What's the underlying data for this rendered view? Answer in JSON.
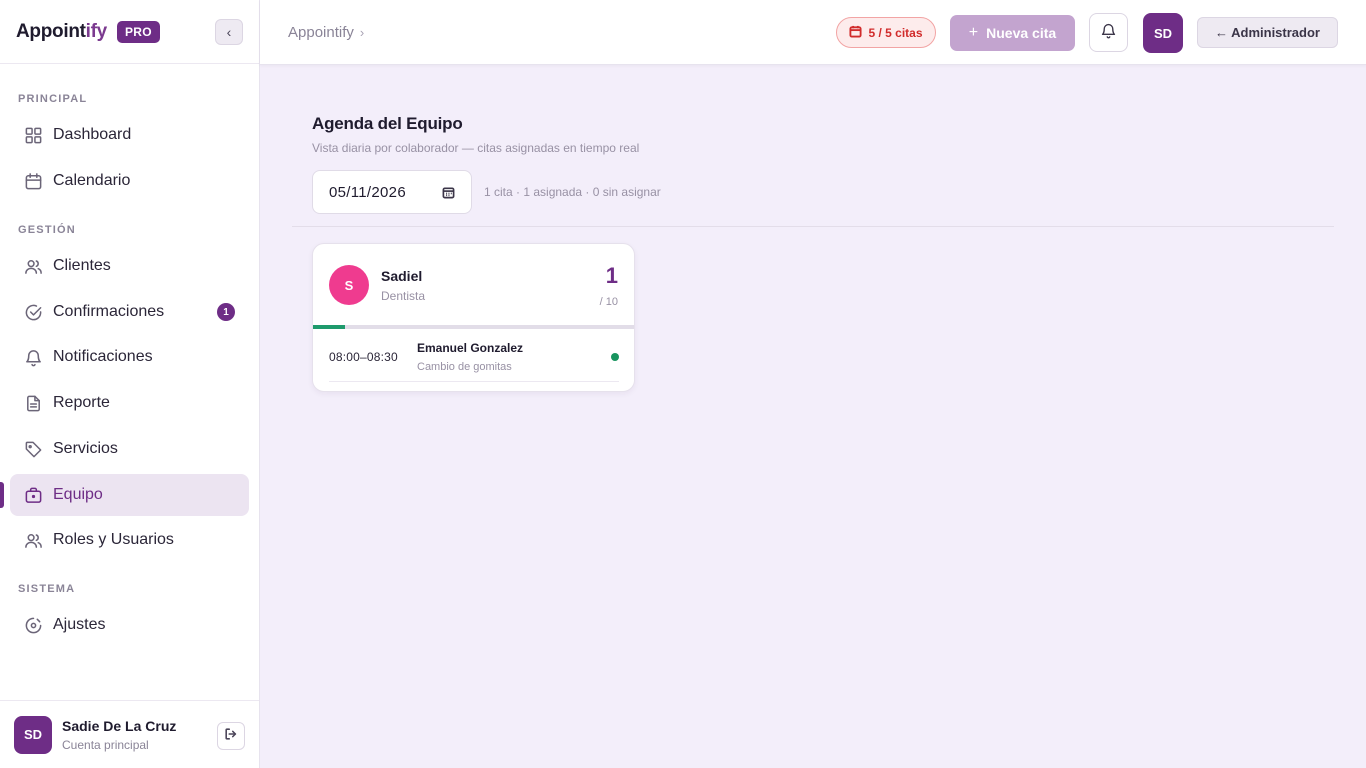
{
  "brand": {
    "name_main": "Appoint",
    "name_accent": "ify",
    "badge": "PRO"
  },
  "sidebar": {
    "sections": {
      "principal": "PRINCIPAL",
      "gestion": "GESTIÓN",
      "sistema": "SISTEMA"
    },
    "items": [
      {
        "label": "Dashboard",
        "icon": "grid-icon"
      },
      {
        "label": "Calendario",
        "icon": "calendar-icon"
      },
      {
        "label": "Clientes",
        "icon": "users-icon"
      },
      {
        "label": "Confirmaciones",
        "icon": "check-circle-icon",
        "badge": "1"
      },
      {
        "label": "Notificaciones",
        "icon": "bell-icon"
      },
      {
        "label": "Reporte",
        "icon": "document-icon"
      },
      {
        "label": "Servicios",
        "icon": "tag-icon"
      },
      {
        "label": "Equipo",
        "icon": "briefcase-icon",
        "active": true
      },
      {
        "label": "Roles y Usuarios",
        "icon": "users-icon"
      },
      {
        "label": "Ajustes",
        "icon": "settings-icon"
      }
    ],
    "user": {
      "initials": "SD",
      "name": "Sadie De La Cruz",
      "role": "Cuenta principal"
    }
  },
  "header": {
    "breadcrumb": "Appointify",
    "breadcrumb_sep": "›",
    "quota": "5 / 5 citas",
    "new_label": "Nueva cita",
    "new_plus": "+",
    "avatar_initials": "SD",
    "admin_label": "← Administrador"
  },
  "main": {
    "title": "Agenda del Equipo",
    "subtitle": "Vista diaria por colaborador — citas asignadas en tiempo real",
    "date_value": "05/11/2026",
    "summary": "1 cita · 1 asignada · 0 sin asignar",
    "staff": [
      {
        "initial": "S",
        "name": "Sadiel",
        "role": "Dentista",
        "count": "1",
        "capacity": "/ 10",
        "load_fraction": 0.1,
        "avatar_color": "#ef3b8f",
        "appointments": [
          {
            "time": "08:00–08:30",
            "client": "Emanuel Gonzalez",
            "service": "Cambio de gomitas",
            "status_color": "#18945f"
          }
        ]
      }
    ]
  },
  "colors": {
    "brand": "#6e2d86",
    "accent_button": "#c3a4cf",
    "progress": "#1e9a6c",
    "quota_alert": "#d12c2c"
  }
}
